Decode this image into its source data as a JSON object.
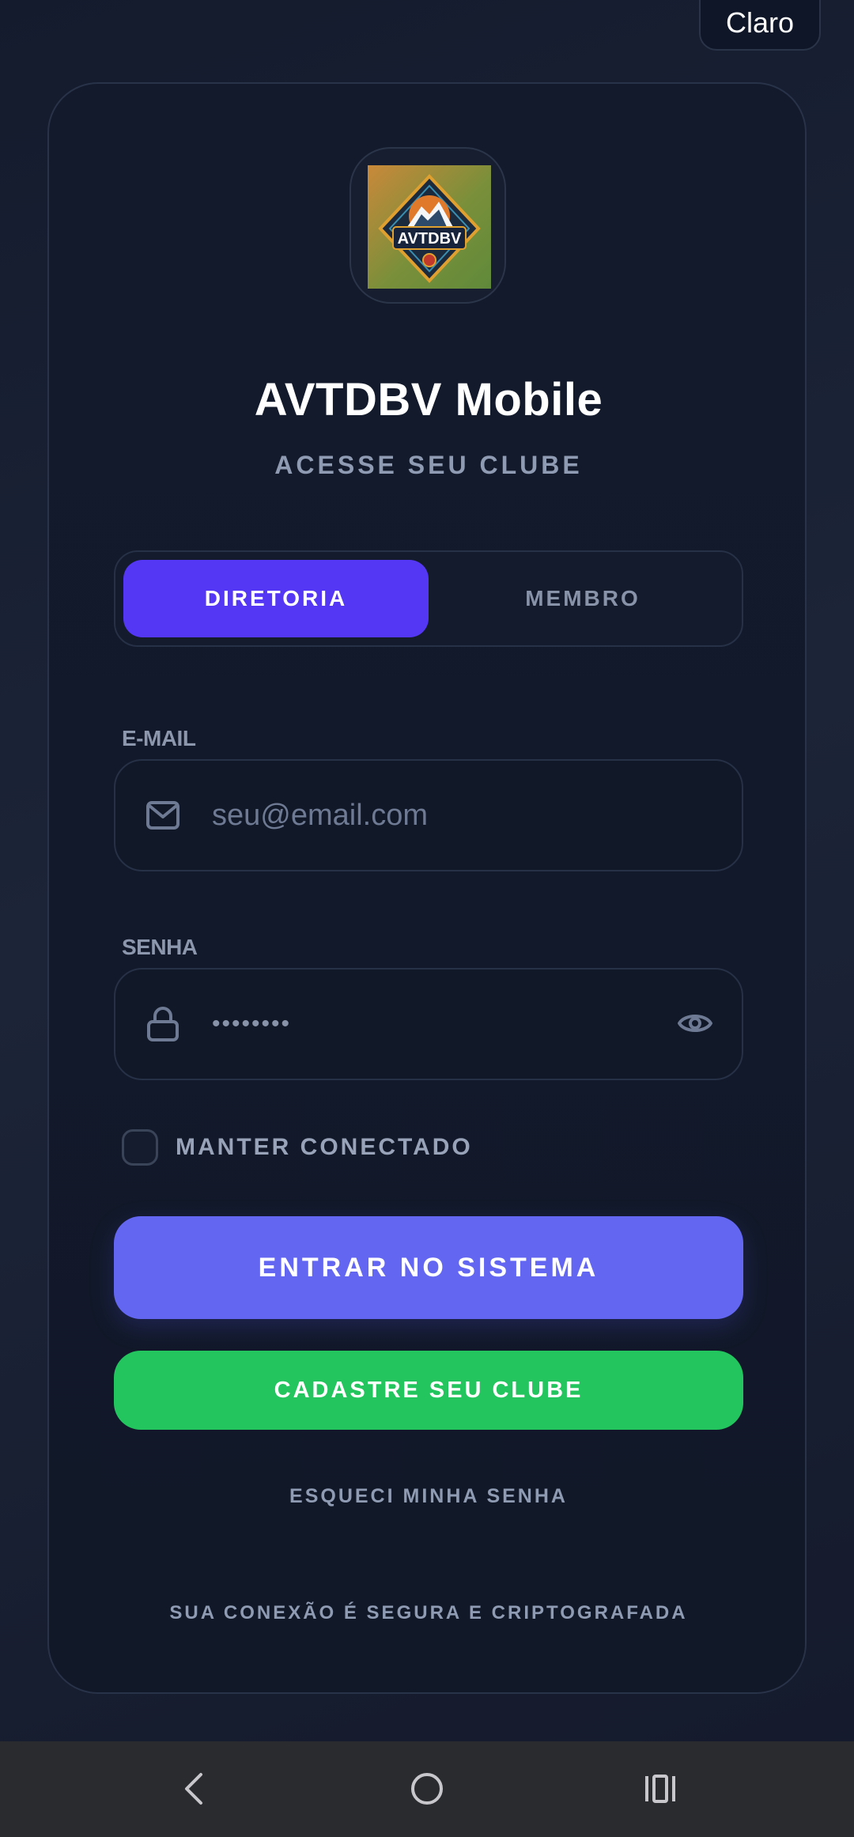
{
  "theme_toggle": {
    "label": "Claro"
  },
  "app": {
    "title": "AVTDBV Mobile",
    "subtitle": "ACESSE SEU CLUBE",
    "logo_text": "AVTDBV"
  },
  "role_tabs": [
    {
      "label": "DIRETORIA",
      "active": true
    },
    {
      "label": "MEMBRO",
      "active": false
    }
  ],
  "email": {
    "label": "E-MAIL",
    "placeholder": "seu@email.com",
    "icon": "mail-icon"
  },
  "password": {
    "label": "SENHA",
    "value": "••••••••",
    "icon": "lock-icon",
    "toggle_icon": "eye-icon"
  },
  "remember": {
    "label": "MANTER CONECTADO",
    "checked": false
  },
  "buttons": {
    "login": "ENTRAR NO SISTEMA",
    "register": "CADASTRE SEU CLUBE",
    "forgot": "ESQUECI MINHA SENHA"
  },
  "footer": {
    "secure_note": "SUA CONEXÃO É SEGURA E CRIPTOGRAFADA"
  },
  "system_nav": {
    "back": "back-icon",
    "home": "home-icon",
    "recents": "recents-icon"
  },
  "colors": {
    "accent": "#5436f5",
    "primary_button": "#6366f1",
    "success_button": "#22c55e",
    "background": "#141b2d"
  }
}
